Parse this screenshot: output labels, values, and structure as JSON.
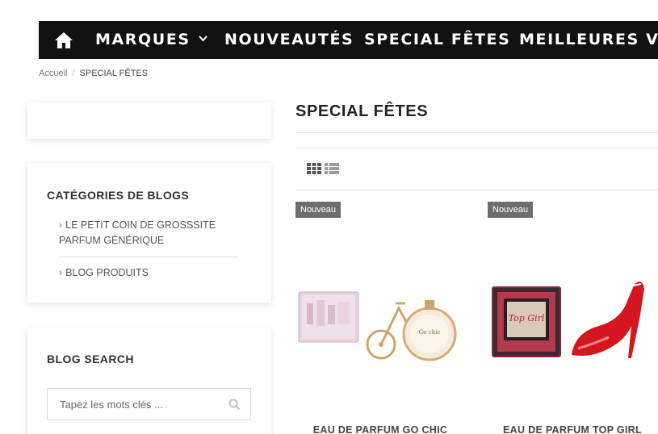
{
  "nav": {
    "home_icon": "home-icon",
    "items": [
      {
        "label": "MARQUES",
        "has_dropdown": true
      },
      {
        "label": "NOUVEAUTÉS"
      },
      {
        "label": "SPECIAL FÊTES"
      },
      {
        "label": "MEILLEURES VENTES"
      }
    ],
    "background": "#111111"
  },
  "breadcrumb": {
    "home": "Accueil",
    "separator": "/",
    "current": "SPECIAL FÊTES"
  },
  "sidebar": {
    "blog_categories": {
      "title": "CATÉGORIES DE BLOGS",
      "items": [
        {
          "label": "LE PETIT COIN DE GROSSSITE PARFUM GÉNÉRIQUE"
        },
        {
          "label": "BLOG PRODUITS"
        }
      ]
    },
    "blog_search": {
      "title": "BLOG SEARCH",
      "placeholder": "Tapez les mots clés ..."
    }
  },
  "main": {
    "title": "SPECIAL FÊTES",
    "view_modes": [
      "grid-view-icon",
      "list-view-icon"
    ],
    "products": [
      {
        "badge": "Nouveau",
        "name": "EAU DE PARFUM GO CHIC"
      },
      {
        "badge": "Nouveau",
        "name": "EAU DE PARFUM TOP GIRL"
      }
    ]
  }
}
